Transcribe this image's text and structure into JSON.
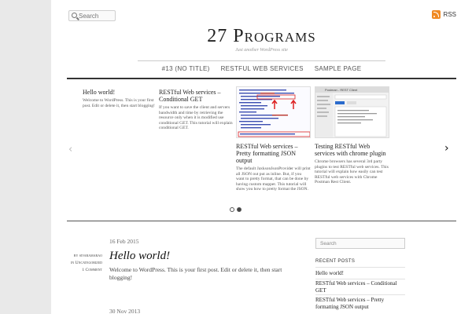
{
  "topbar": {
    "search_placeholder": "Search",
    "rss_label": "RSS",
    "rss_color": "#f08a24"
  },
  "header": {
    "site_title": "27 Programs",
    "tagline": "Just another WordPress site"
  },
  "nav": {
    "items": [
      "#13 (NO TITLE)",
      "RESTFUL WEB SERVICES",
      "SAMPLE PAGE"
    ]
  },
  "slider": {
    "prev_icon": "‹",
    "next_icon": "›",
    "slides": [
      {
        "title": "Hello world!",
        "excerpt": "Welcome to WordPress. This is your first post. Edit or delete it, then start blogging!"
      },
      {
        "title": "RESTful Web services – Conditional GET",
        "excerpt": "If you want to save the client and servers bandwidth and time by retrieving the resource only when it is modified use conditional GET. This tutorial will explain conditional GET."
      },
      {
        "title": "RESTful Web services – Pretty formatting JSON output",
        "excerpt": "The default JaxksonJsonProvider will print all JSON out put as inline. But, if you want to pretty format, that can be done by having custom mapper. This tutorial will show you how to pretty format the JSON."
      },
      {
        "title": "Testing RESTful Web services with chrome plugin",
        "excerpt": "Chrome browsers has several 3rd party plugins to test RESTful web services. This tutorial will explain how easily can test RESTful web services with Chrome Postman Rest Client."
      }
    ],
    "thumb_window_title": "Postman - REST Client",
    "pages": 2,
    "active_page": 2
  },
  "posts": [
    {
      "date": "16 Feb 2015",
      "author": "by sivaramarao",
      "category_prefix": "in",
      "category": "Uncategorized",
      "comments": "1 Comment",
      "title": "Hello world!",
      "excerpt": "Welcome to WordPress. This is your first post. Edit or delete it, then start blogging!"
    },
    {
      "date": "30 Nov 2013"
    }
  ],
  "sidebar": {
    "search_placeholder": "Search",
    "recent_heading": "RECENT POSTS",
    "recent_posts": [
      "Hello world!",
      "RESTful Web services – Conditional GET",
      "RESTful Web services – Pretty formatting JSON output"
    ]
  }
}
